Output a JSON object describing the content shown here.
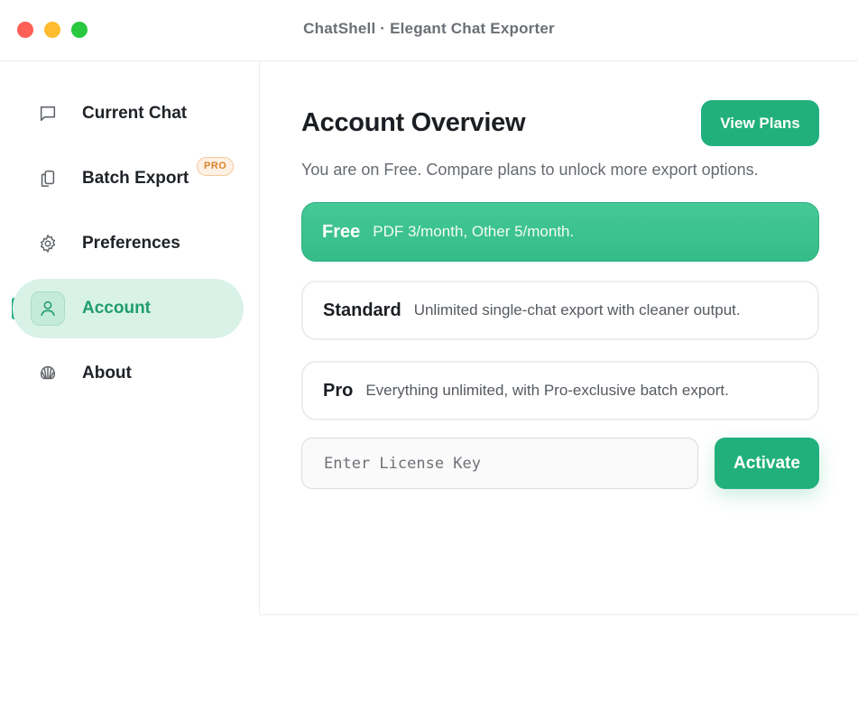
{
  "window": {
    "title": "ChatShell · Elegant Chat Exporter",
    "controls": [
      "close",
      "minimize",
      "zoom"
    ]
  },
  "sidebar": {
    "items": [
      {
        "label": "Current Chat",
        "icon": "chat-bubble-icon",
        "active": false
      },
      {
        "label": "Batch Export",
        "icon": "copy-icon",
        "active": false,
        "badge": "PRO"
      },
      {
        "label": "Preferences",
        "icon": "gear-icon",
        "active": false
      },
      {
        "label": "Account",
        "icon": "user-icon",
        "active": true
      },
      {
        "label": "About",
        "icon": "shell-icon",
        "active": false
      }
    ]
  },
  "main": {
    "title": "Account Overview",
    "view_plans_label": "View Plans",
    "subtitle": "You are on Free. Compare plans to unlock more export options.",
    "plans": [
      {
        "name": "Free",
        "description": "PDF 3/month, Other 5/month.",
        "selected": true
      },
      {
        "name": "Standard",
        "description": "Unlimited single-chat export with cleaner output.",
        "selected": false
      },
      {
        "name": "Pro",
        "description": "Everything unlimited, with Pro-exclusive batch export.",
        "selected": false
      }
    ],
    "license": {
      "placeholder": "Enter License Key",
      "value": "",
      "activate_label": "Activate"
    }
  },
  "colors": {
    "accent": "#21b07c",
    "accent_light": "#d9f2e8",
    "pro_badge": "#d9822b",
    "traffic_red": "#fe5f57",
    "traffic_yellow": "#febc2e",
    "traffic_green": "#28c840"
  }
}
